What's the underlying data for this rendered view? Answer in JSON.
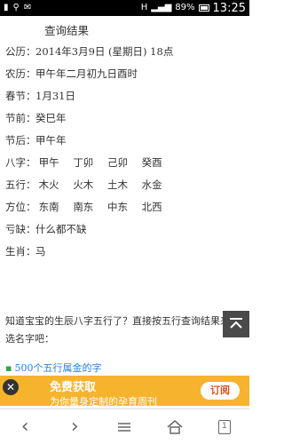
{
  "status_bar": {
    "left_icons": [
      "signal-icon",
      "usb-icon",
      "notification-icon"
    ],
    "network": "H",
    "battery": "89%",
    "time": "13:25"
  },
  "section_title": "查询结果",
  "rows": [
    {
      "label": "公历：",
      "value": "2014年3月9日 (星期日) 18点"
    },
    {
      "label": "农历：",
      "value": "甲午年二月初九日酉时"
    },
    {
      "label": "春节：",
      "value": "1月31日"
    },
    {
      "label": "节前：",
      "value": "癸巳年"
    },
    {
      "label": "节后：",
      "value": "甲午年"
    }
  ],
  "grid_rows": [
    {
      "label": "八字：",
      "cells": [
        "甲午",
        "丁卯",
        "己卯",
        "癸酉"
      ]
    },
    {
      "label": "五行：",
      "cells": [
        "木火",
        "火木",
        "土木",
        "水金"
      ]
    },
    {
      "label": "方位：",
      "cells": [
        "东南",
        "南东",
        "中东",
        "北西"
      ]
    }
  ],
  "extra_rows": [
    {
      "label": "亏缺：",
      "value": "什么都不缺"
    },
    {
      "label": "生肖：",
      "value": "马"
    }
  ],
  "promo_text": "知道宝宝的生辰八字五行了？直接按五行查询结果来挑选名字吧：",
  "link": {
    "label": "500个五行属金的字"
  },
  "ad": {
    "title": "免费获取",
    "subtitle": "为你量身定制的孕育周刊",
    "button": "订阅"
  },
  "nav": {
    "back": "‹",
    "forward": "›",
    "page_count": "1"
  }
}
